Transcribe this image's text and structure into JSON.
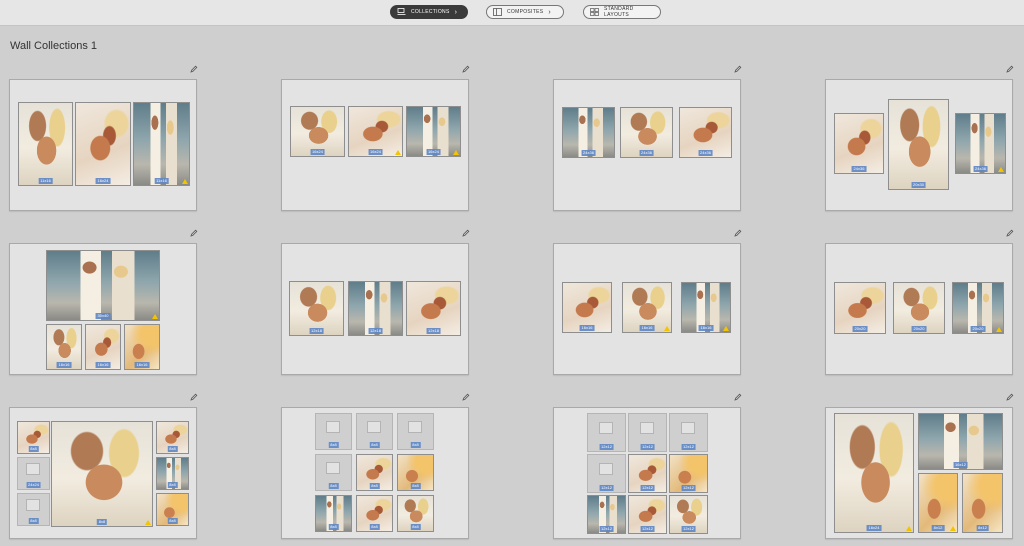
{
  "toolbar": {
    "collections": {
      "label": "COLLECTIONS",
      "icon": "collections-icon"
    },
    "composites": {
      "label": "COMPOSITES",
      "icon": "composites-icon"
    },
    "standard_layouts": {
      "label": "STANDARD LAYOUTS",
      "icon": "grid-icon"
    }
  },
  "page_title": "Wall Collections 1",
  "colors": {
    "accent": "#3a3a3a",
    "label_bg": "#5e86c4",
    "warning": "#f3c400"
  },
  "cards": [
    {
      "photos": [
        {
          "label": "11x16"
        },
        {
          "label": "16x24"
        },
        {
          "label": "11x16"
        }
      ]
    },
    {
      "photos": [
        {
          "label": "16x24"
        },
        {
          "label": "16x24"
        },
        {
          "label": "16x24"
        }
      ]
    },
    {
      "photos": [
        {
          "label": "24x36"
        },
        {
          "label": "24x36"
        },
        {
          "label": "24x36"
        }
      ]
    },
    {
      "photos": [
        {
          "label": "24x36"
        },
        {
          "label": "20x30"
        },
        {
          "label": "24x36"
        }
      ]
    },
    {
      "photos": [
        {
          "label": "30x40"
        },
        {
          "label": "16x16"
        },
        {
          "label": "16x16"
        },
        {
          "label": "16x16"
        }
      ]
    },
    {
      "photos": [
        {
          "label": "12x18"
        },
        {
          "label": "12x18"
        },
        {
          "label": "12x18"
        }
      ]
    },
    {
      "photos": [
        {
          "label": "16x16"
        },
        {
          "label": "16x16"
        },
        {
          "label": "16x16"
        }
      ]
    },
    {
      "photos": [
        {
          "label": "20x20"
        },
        {
          "label": "20x20"
        },
        {
          "label": "20x20"
        }
      ]
    },
    {
      "photos": [
        {
          "label": "8x8"
        },
        {
          "label": "8x8"
        },
        {
          "label": "8x8"
        },
        {
          "label": "24x24"
        },
        {
          "label": "8x8"
        },
        {
          "label": "8x8"
        },
        {
          "label": "8x8"
        }
      ]
    },
    {
      "photos": [
        {
          "label": "8x8"
        },
        {
          "label": "8x8"
        },
        {
          "label": "8x8"
        },
        {
          "label": "8x8"
        },
        {
          "label": "8x8"
        },
        {
          "label": "8x8"
        },
        {
          "label": "8x8"
        },
        {
          "label": "8x8"
        },
        {
          "label": "8x8"
        }
      ]
    },
    {
      "photos": [
        {
          "label": "12x12"
        },
        {
          "label": "12x12"
        },
        {
          "label": "12x12"
        },
        {
          "label": "12x12"
        },
        {
          "label": "12x12"
        },
        {
          "label": "12x12"
        },
        {
          "label": "12x12"
        },
        {
          "label": "12x12"
        },
        {
          "label": "12x12"
        }
      ]
    },
    {
      "photos": [
        {
          "label": "16x24"
        },
        {
          "label": "16x12"
        },
        {
          "label": "8x12"
        },
        {
          "label": "8x12"
        }
      ]
    }
  ]
}
